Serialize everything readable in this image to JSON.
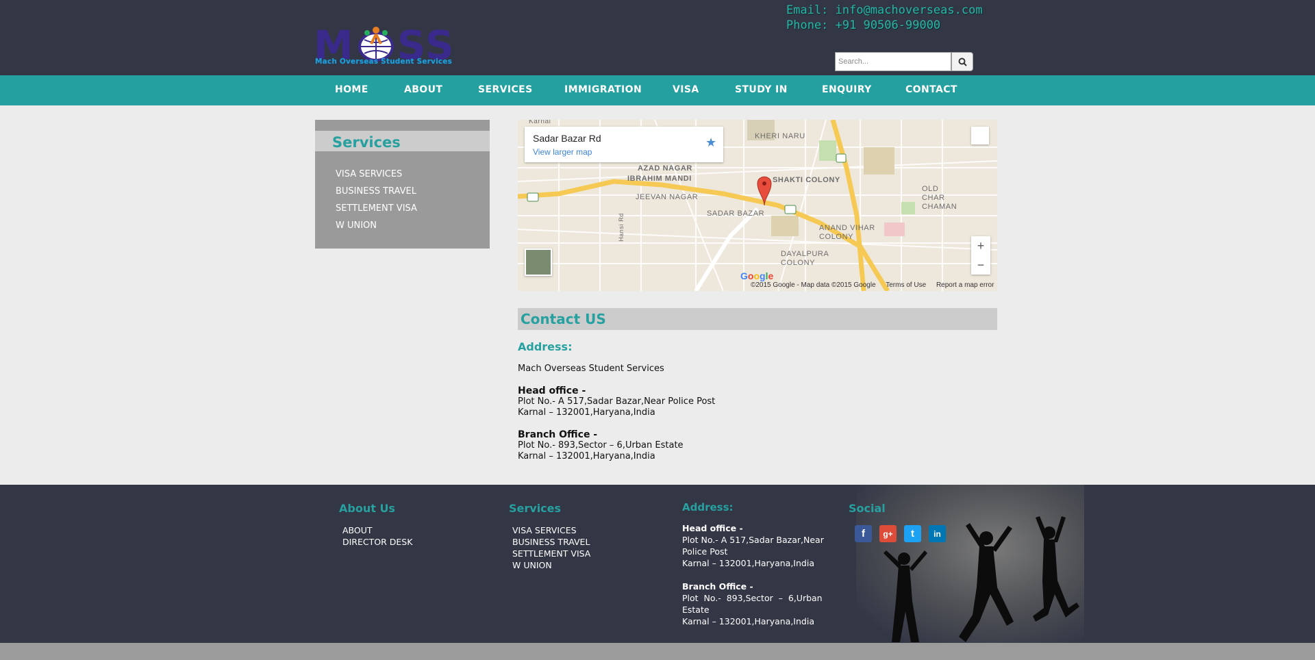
{
  "header": {
    "logo_word_m": "M",
    "logo_word_ss": "SS",
    "logo_tagline": "Mach Overseas Student Services",
    "email_line": "Email: info@machoverseas.com",
    "phone_line": "Phone: +91 90506-99000",
    "search_placeholder": "Search..."
  },
  "nav": {
    "items": [
      "HOME",
      "ABOUT",
      "SERVICES",
      "IMMIGRATION",
      "VISA",
      "STUDY IN",
      "ENQUIRY",
      "CONTACT"
    ]
  },
  "sidebar": {
    "title": "Services",
    "items": [
      "VISA SERVICES",
      "BUSINESS TRAVEL",
      "SETTLEMENT VISA",
      "W UNION"
    ]
  },
  "map": {
    "place_name": "Sadar Bazar Rd",
    "larger_map_link": "View larger map",
    "copyright": "©2015 Google - Map data ©2015 Google",
    "terms": "Terms of Use",
    "report": "Report a map error",
    "labels": [
      "KHERI NARU",
      "AZAD NAGAR",
      "IBRAHIM MANDI",
      "SHAKTI COLONY",
      "OLD CHAR CHAMAN",
      "JEEVAN NAGAR",
      "SADAR BAZAR",
      "ANAND VIHAR COLONY",
      "DAYALPURA COLONY",
      "Hansi Rd",
      "Karnal"
    ],
    "zoom_in": "+",
    "zoom_out": "−"
  },
  "contact": {
    "title": "Contact US",
    "address_heading": "Address:",
    "company": "Mach Overseas Student Services",
    "head_office_label": "Head office -",
    "head_office_line1": "Plot No.- A 517,Sadar Bazar,Near Police Post",
    "head_office_line2": "Karnal – 132001,Haryana,India",
    "branch_office_label": "Branch Office -",
    "branch_office_line1": "Plot No.- 893,Sector – 6,Urban Estate",
    "branch_office_line2": "Karnal – 132001,Haryana,India"
  },
  "footer": {
    "about_heading": "About Us",
    "about_links": [
      "ABOUT",
      "DIRECTOR DESK"
    ],
    "services_heading": "Services",
    "services_links": [
      "VISA SERVICES",
      "BUSINESS TRAVEL",
      "SETTLEMENT VISA",
      "W UNION"
    ],
    "address_heading": "Address:",
    "head_office_label": "Head office -",
    "head_office_line1": "Plot No.- A 517,Sadar Bazar,Near",
    "head_office_line2": "Police Post",
    "head_office_line3": "Karnal – 132001,Haryana,India",
    "branch_office_label": "Branch Office -",
    "branch_office_line1": "Plot  No.-  893,Sector  –  6,Urban",
    "branch_office_line2": "Estate",
    "branch_office_line3": "Karnal – 132001,Haryana,India",
    "social_heading": "Social",
    "social": [
      {
        "icon": "facebook-icon",
        "glyph": "f",
        "color": "#3b5998"
      },
      {
        "icon": "google-plus-icon",
        "glyph": "g+",
        "color": "#dd4b39"
      },
      {
        "icon": "twitter-icon",
        "glyph": "t",
        "color": "#1da1f2"
      },
      {
        "icon": "linkedin-icon",
        "glyph": "in",
        "color": "#0077b5"
      }
    ]
  },
  "colors": {
    "header_bg": "#333645",
    "accent_teal": "#24a0a0",
    "sidebar_bg": "#9a9a9a",
    "band_gray": "#cccccc"
  }
}
